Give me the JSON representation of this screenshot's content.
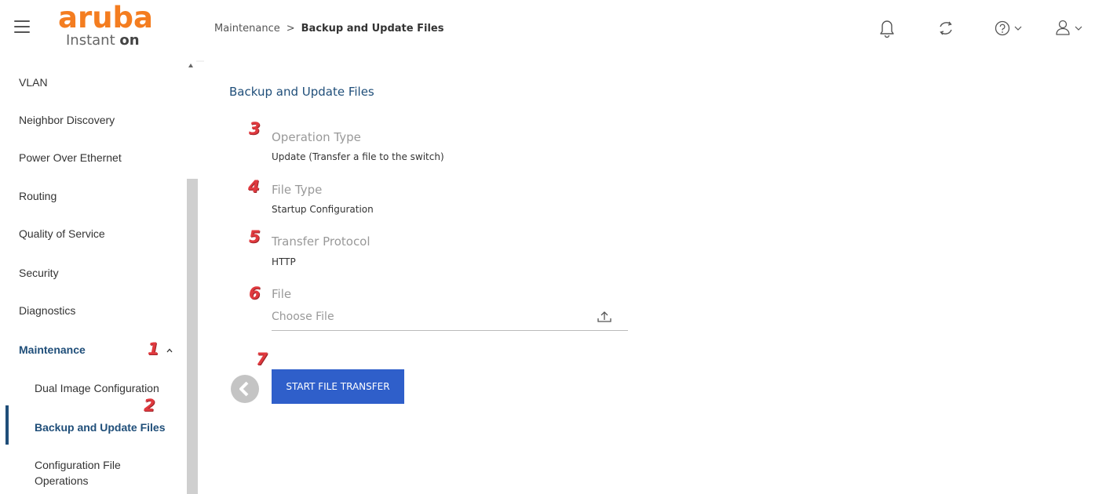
{
  "app": {
    "logo_main": "aruba",
    "logo_sub_text": "Instant",
    "logo_sub_bold": "on"
  },
  "header": {
    "breadcrumb": {
      "parent": "Maintenance",
      "separator": ">",
      "current": "Backup and Update Files"
    },
    "icons": [
      "bell-icon",
      "refresh-icon",
      "help-icon",
      "user-icon"
    ]
  },
  "sidebar": {
    "items": [
      {
        "label": "VLAN"
      },
      {
        "label": "Neighbor Discovery"
      },
      {
        "label": "Power Over Ethernet"
      },
      {
        "label": "Routing"
      },
      {
        "label": "Quality of Service"
      },
      {
        "label": "Security"
      },
      {
        "label": "Diagnostics"
      },
      {
        "label": "Maintenance"
      }
    ],
    "sub_items": [
      {
        "label": "Dual Image Configuration"
      },
      {
        "label": "Backup and Update Files"
      },
      {
        "label": "Configuration File Operations"
      }
    ]
  },
  "annotations": [
    "1",
    "2",
    "3",
    "4",
    "5",
    "6",
    "7"
  ],
  "main": {
    "title": "Backup and Update Files",
    "fields": [
      {
        "label": "Operation Type",
        "value": "Update (Transfer a file to the switch)"
      },
      {
        "label": "File Type",
        "value": "Startup Configuration"
      },
      {
        "label": "Transfer Protocol",
        "value": "HTTP"
      },
      {
        "label": "File",
        "placeholder": "Choose File"
      }
    ],
    "start_button": "START FILE TRANSFER"
  },
  "colors": {
    "brand_orange": "#f47d20",
    "accent_blue": "#1f4e79",
    "button_blue": "#2f5fca",
    "marker_red": "#e0393e"
  }
}
